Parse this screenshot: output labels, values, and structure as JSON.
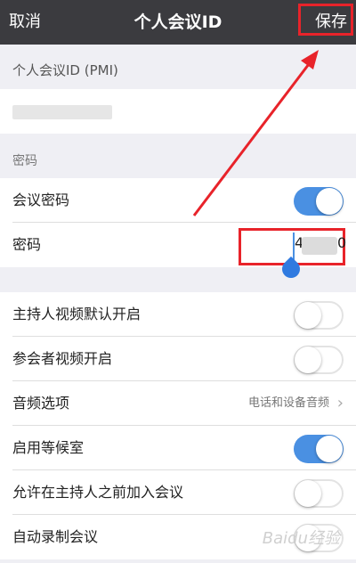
{
  "navbar": {
    "cancel_label": "取消",
    "title": "个人会议ID",
    "save_label": "保存"
  },
  "sections": {
    "pmi_header": "个人会议ID (PMI)",
    "password_header": "密码"
  },
  "rows": {
    "meeting_password": {
      "label": "会议密码",
      "on": true
    },
    "password": {
      "label": "密码",
      "value_prefix": "4",
      "value_suffix": "0"
    },
    "host_video": {
      "label": "主持人视频默认开启",
      "on": false
    },
    "participant_video": {
      "label": "参会者视频开启",
      "on": false
    },
    "audio_option": {
      "label": "音频选项",
      "value": "电话和设备音频"
    },
    "waiting_room": {
      "label": "启用等候室",
      "on": true
    },
    "join_before_host": {
      "label": "允许在主持人之前加入会议",
      "on": false
    },
    "auto_record": {
      "label": "自动录制会议",
      "on": false
    }
  },
  "watermark": "Baidu经验",
  "colors": {
    "navbar_bg": "#3b3b3f",
    "toggle_on": "#4a90e2",
    "annotation_red": "#e8232a"
  }
}
